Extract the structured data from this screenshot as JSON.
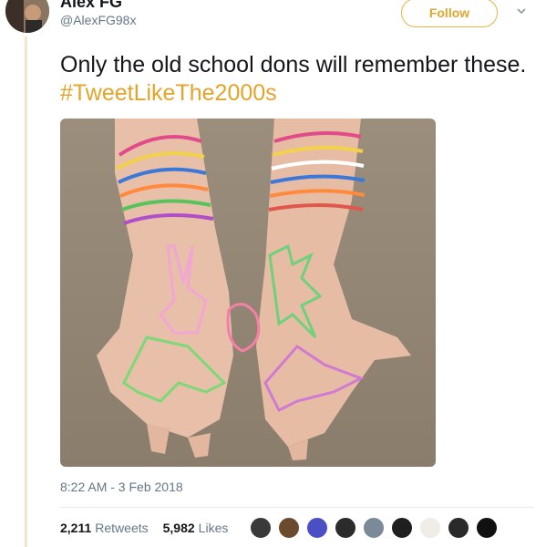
{
  "author": {
    "display_name": "Alex FG",
    "handle": "@AlexFG98x"
  },
  "follow_label": "Follow",
  "tweet": {
    "text": "Only the old school dons will remember these.",
    "hashtag": "#TweetLikeThe2000s"
  },
  "timestamp": "8:22 AM - 3 Feb 2018",
  "stats": {
    "retweets_count": "2,211",
    "retweets_label": "Retweets",
    "likes_count": "5,982",
    "likes_label": "Likes"
  },
  "likers": [
    "#3a3a3a",
    "#6b4a2e",
    "#4a4fc4",
    "#2b2b2b",
    "#7a8a99",
    "#1f1f1f",
    "#f0ece6",
    "#2a2a2a",
    "#111111"
  ],
  "colors": {
    "accent": "#e3a42a",
    "muted": "#657786"
  },
  "icons": {
    "more": "chevron-down-icon"
  }
}
